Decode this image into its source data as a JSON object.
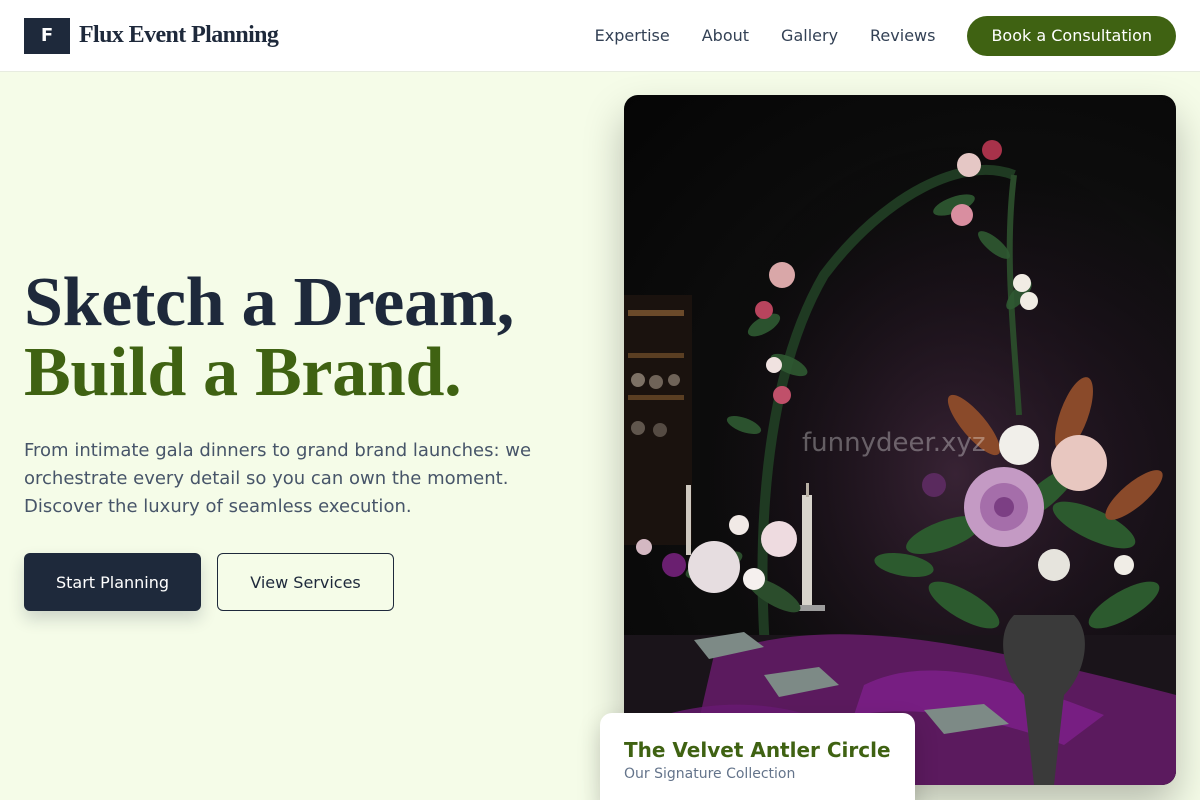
{
  "brand": {
    "logo_letter": "F",
    "name": "Flux Event Planning"
  },
  "nav": {
    "links": [
      "Expertise",
      "About",
      "Gallery",
      "Reviews"
    ],
    "cta": "Book a Consultation"
  },
  "hero": {
    "title_line1": "Sketch a Dream,",
    "title_line2": "Build a Brand.",
    "description": "From intimate gala dinners to grand brand launches: we orchestrate every detail so you can own the moment. Discover the luxury of seamless execution.",
    "primary_button": "Start Planning",
    "secondary_button": "View Services"
  },
  "image": {
    "description_icon": "floral-table-photo",
    "watermark": "funnydeer.xyz"
  },
  "caption": {
    "title": "The Velvet Antler Circle",
    "subtitle": "Our Signature Collection"
  },
  "colors": {
    "navy": "#1e293b",
    "olive": "#3f6212",
    "background": "#f5fce8"
  }
}
